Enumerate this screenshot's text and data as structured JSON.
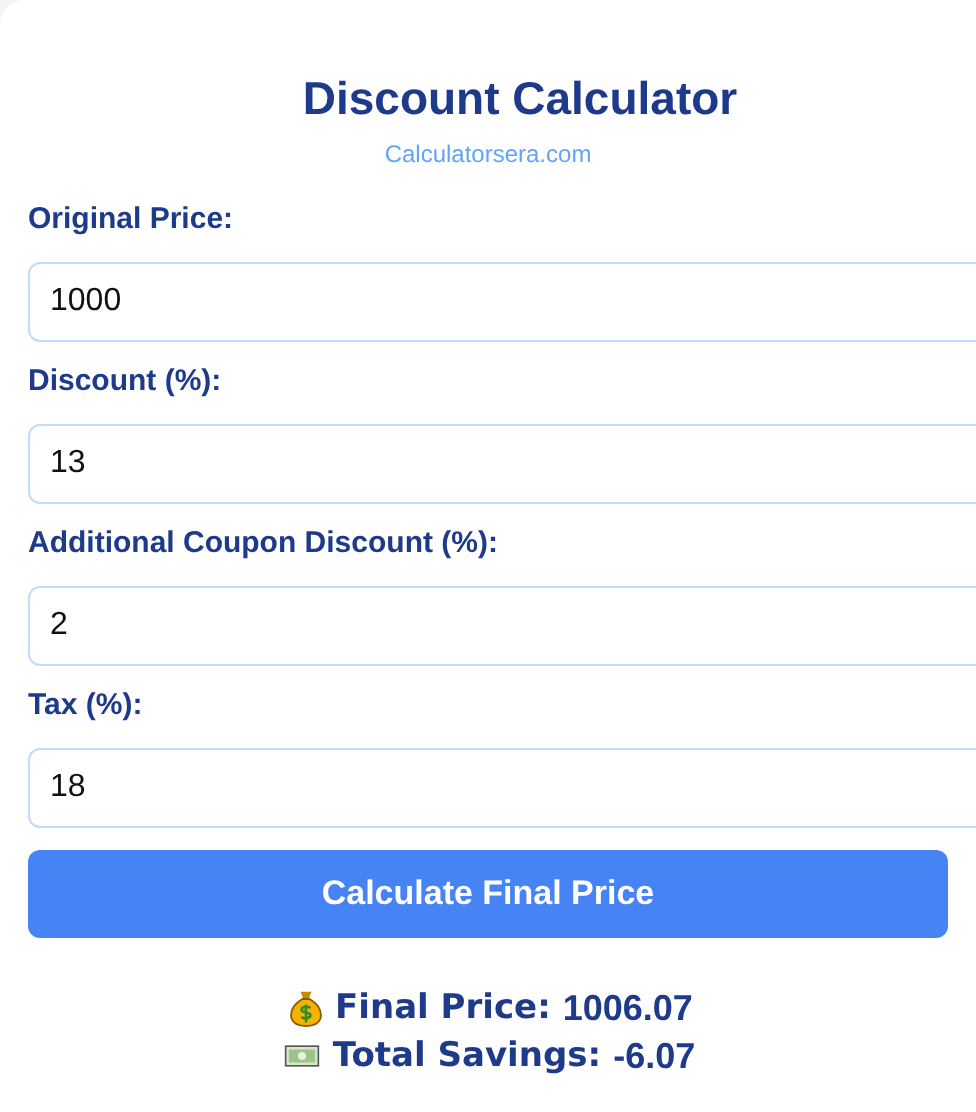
{
  "title": "Discount Calculator",
  "subtitle": "Calculatorsera.com",
  "fields": [
    {
      "label": "Original Price:",
      "value": "1000"
    },
    {
      "label": "Discount (%):",
      "value": "13"
    },
    {
      "label": "Additional Coupon Discount (%):",
      "value": "2"
    },
    {
      "label": "Tax (%):",
      "value": "18"
    }
  ],
  "button": "Calculate Final Price",
  "results": [
    {
      "kind": "bag",
      "label": "Final Price:",
      "value": "1006.07"
    },
    {
      "kind": "cash",
      "label": "Total Savings:",
      "value": "-6.07"
    }
  ]
}
